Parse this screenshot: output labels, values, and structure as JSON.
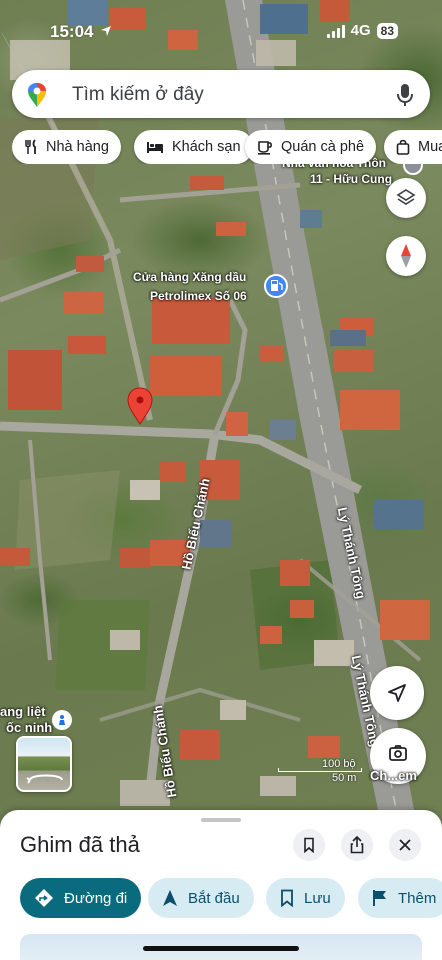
{
  "status_bar": {
    "time": "15:04",
    "network": "4G",
    "battery": "83"
  },
  "search": {
    "placeholder": "Tìm kiếm ở đây",
    "logo_icon": "google-maps-pin-icon",
    "mic_icon": "microphone-icon"
  },
  "chips": [
    {
      "label": "Nhà hàng",
      "icon": "fork-knife-icon"
    },
    {
      "label": "Khách sạn",
      "icon": "bed-icon"
    },
    {
      "label": "Quán cà phê",
      "icon": "coffee-cup-icon"
    },
    {
      "label": "Mua",
      "icon": "shopping-bag-icon"
    }
  ],
  "map": {
    "place_labels": {
      "poi_line1": "Cửa hàng Xăng dầu",
      "poi_line2": "Petrolimex Số 06",
      "top_line1": "Nhà văn hóa Thôn",
      "top_line2": "11 - Hữu Cung",
      "street_view_line1": "ang liệt",
      "street_view_line2": "ốc ninh"
    },
    "road_labels": {
      "ho_bieu_chanh_1": "Hồ Biểu Chánh",
      "ho_bieu_chanh_2": "Hồ Biểu Chánh",
      "ly_thanh_tong_1": "Lý Thánh Tông",
      "ly_thanh_tong_2": "Lý Thánh Tông"
    },
    "scale": {
      "feet": "100 bộ",
      "meters": "50 m"
    },
    "street_view_label": "Ch...em",
    "pin_color": "#ea4335",
    "poi_color": "#4285f4"
  },
  "sheet": {
    "title": "Ghim đã thả",
    "actions": [
      {
        "label": "Đường đi",
        "icon": "directions-diamond-icon"
      },
      {
        "label": "Bắt đầu",
        "icon": "navigation-arrow-icon"
      },
      {
        "label": "Lưu",
        "icon": "bookmark-icon"
      },
      {
        "label": "Thêm",
        "icon": "flag-icon"
      }
    ],
    "primary_color": "#0b6b7e"
  }
}
